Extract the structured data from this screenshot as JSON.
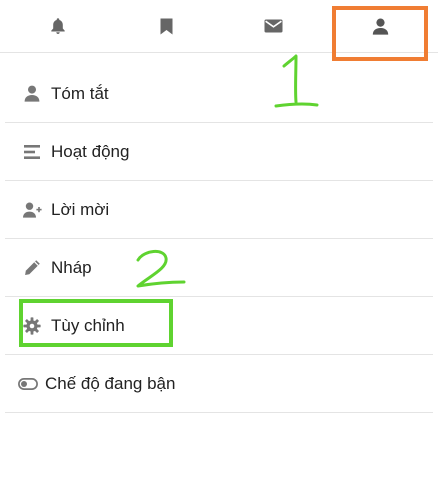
{
  "tabs": [
    {
      "icon": "bell-icon",
      "name": "tab-notifications",
      "active": false
    },
    {
      "icon": "bookmark-icon",
      "name": "tab-bookmarks",
      "active": false
    },
    {
      "icon": "envelope-icon",
      "name": "tab-messages",
      "active": false
    },
    {
      "icon": "user-icon",
      "name": "tab-profile",
      "active": true
    }
  ],
  "menu": {
    "items": [
      {
        "label": "Tóm tắt",
        "icon": "user-icon"
      },
      {
        "label": "Hoạt động",
        "icon": "activity-stream-icon"
      },
      {
        "label": "Lời mời",
        "icon": "user-plus-icon"
      },
      {
        "label": "Nháp",
        "icon": "pencil-icon"
      },
      {
        "label": "Tùy chỉnh",
        "icon": "gear-icon"
      },
      {
        "label": "Chế độ đang bận",
        "icon": "toggle-off-icon"
      }
    ]
  },
  "annotations": {
    "step1_number": "1",
    "step2_number": "2",
    "box1_color": "#f07d33",
    "box2_color": "#5fd330"
  },
  "colors": {
    "icon": "#666666",
    "divider": "#e4e4e4"
  }
}
